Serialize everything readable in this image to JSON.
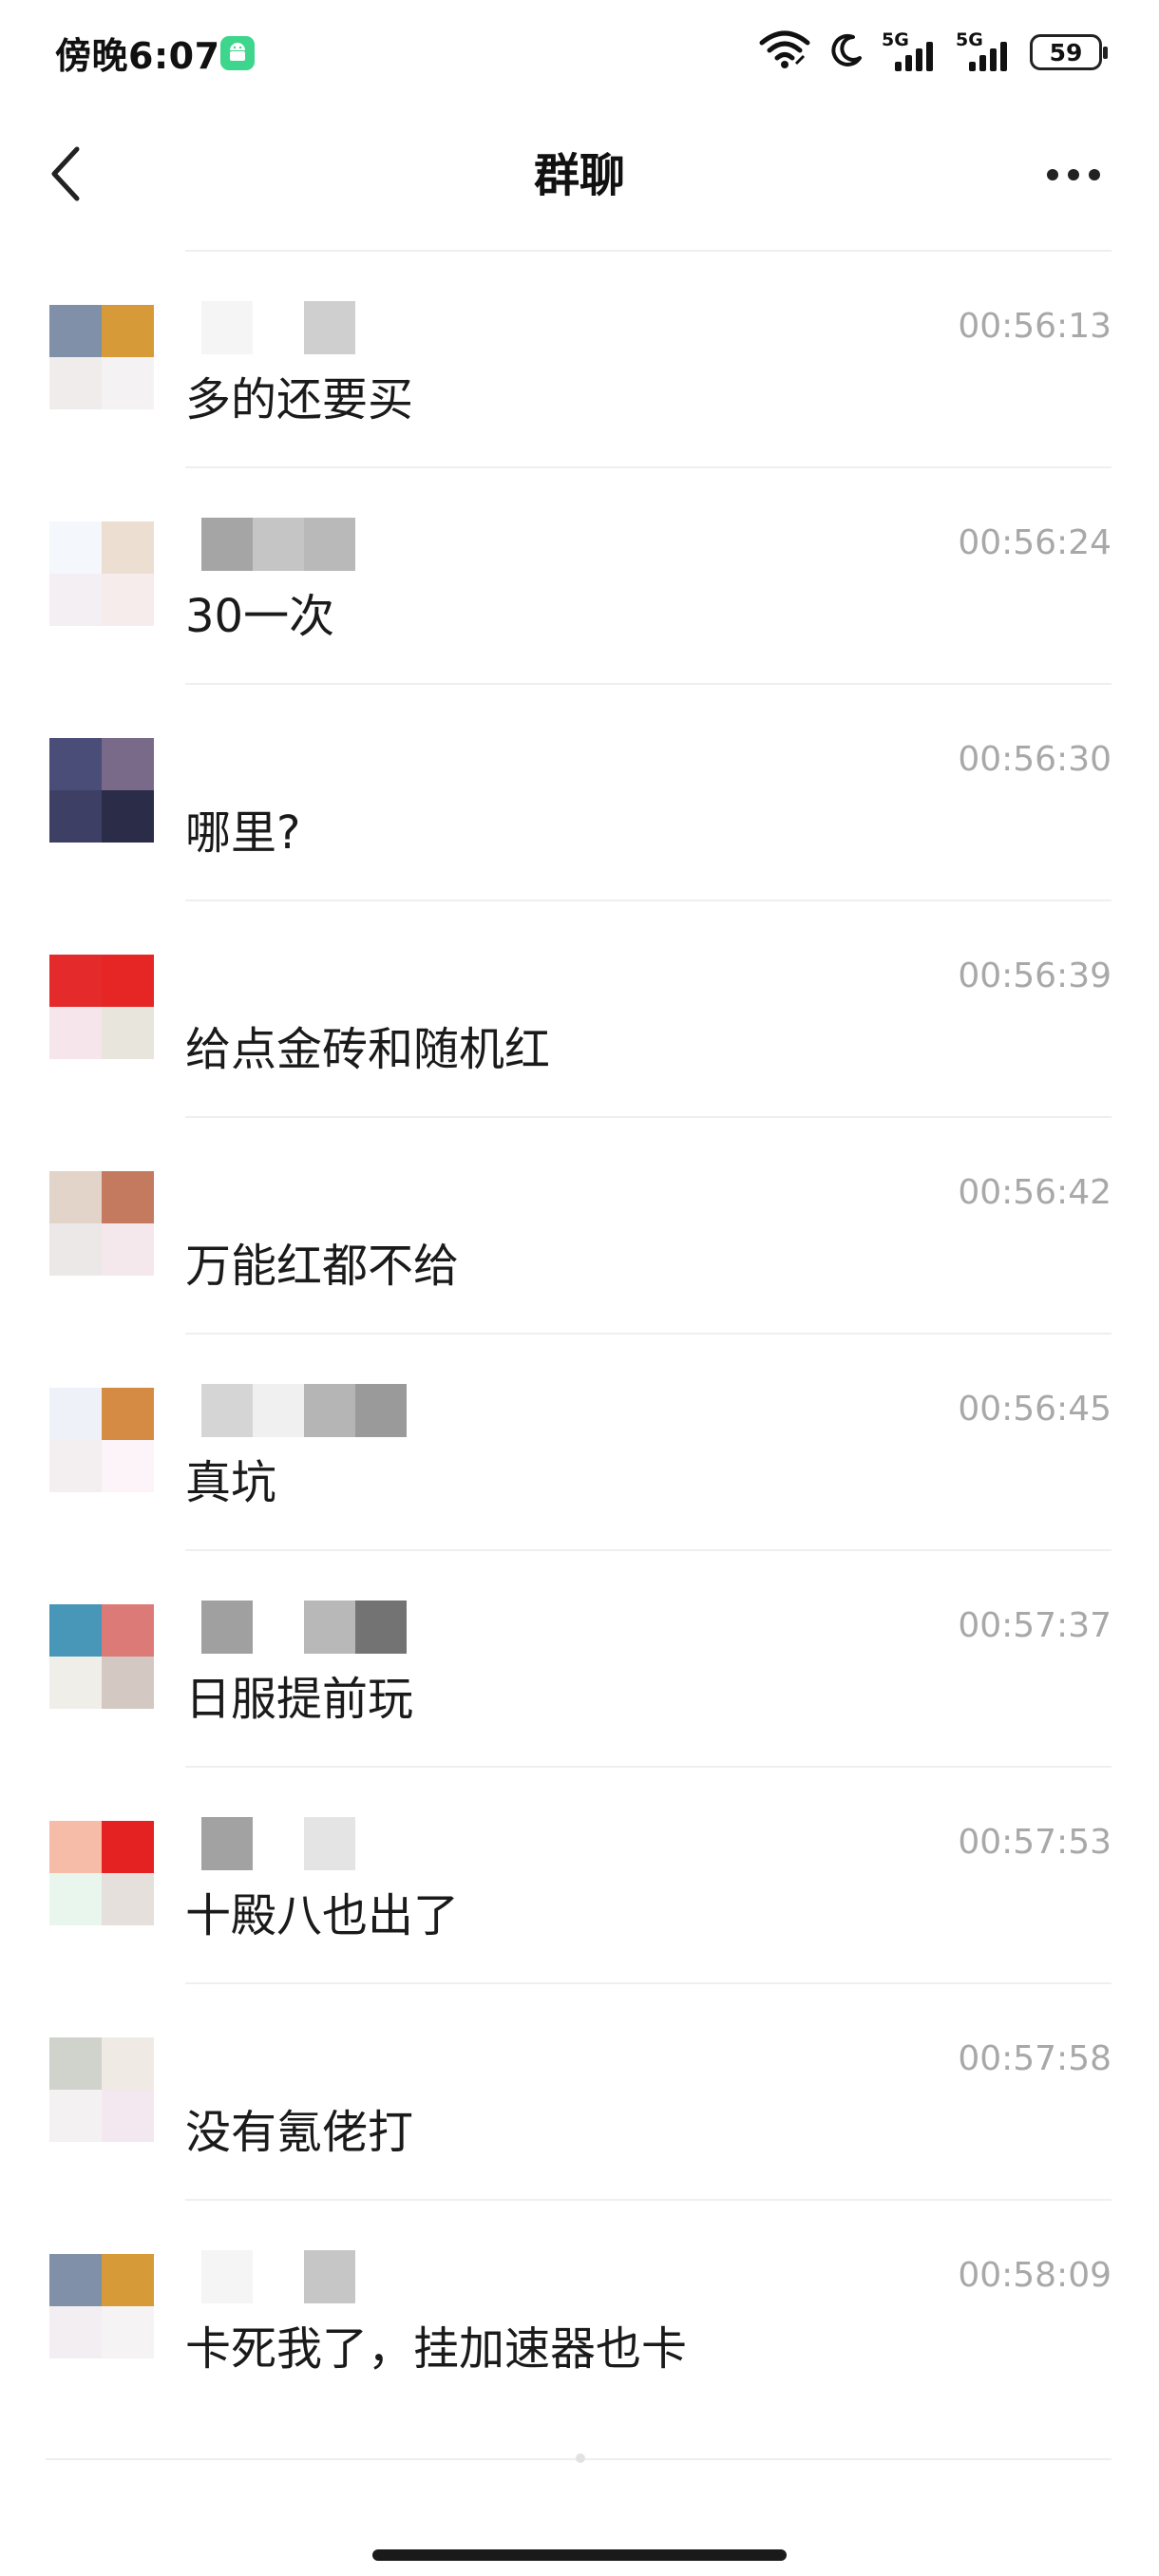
{
  "status_bar": {
    "time": "傍晚6:07",
    "network_1": "5G",
    "network_2": "5G",
    "battery": "59"
  },
  "nav": {
    "title": "群聊",
    "back_icon": "chevron-left-icon",
    "more_icon": "more-horizontal-icon"
  },
  "messages": [
    {
      "time": "00:56:13",
      "text": "多的还要买"
    },
    {
      "time": "00:56:24",
      "text": "30一次"
    },
    {
      "time": "00:56:30",
      "text": "哪里?"
    },
    {
      "time": "00:56:39",
      "text": "给点金砖和随机红"
    },
    {
      "time": "00:56:42",
      "text": "万能红都不给"
    },
    {
      "time": "00:56:45",
      "text": "真坑"
    },
    {
      "time": "00:57:37",
      "text": "日服提前玩"
    },
    {
      "time": "00:57:53",
      "text": "十殿八也出了"
    },
    {
      "time": "00:57:58",
      "text": "没有氪佬打"
    },
    {
      "time": "00:58:09",
      "text": "卡死我了，挂加速器也卡"
    }
  ],
  "colors": {
    "time_text": "#a8a8a8",
    "divider": "#efefef",
    "android_badge": "#3dd68c"
  }
}
